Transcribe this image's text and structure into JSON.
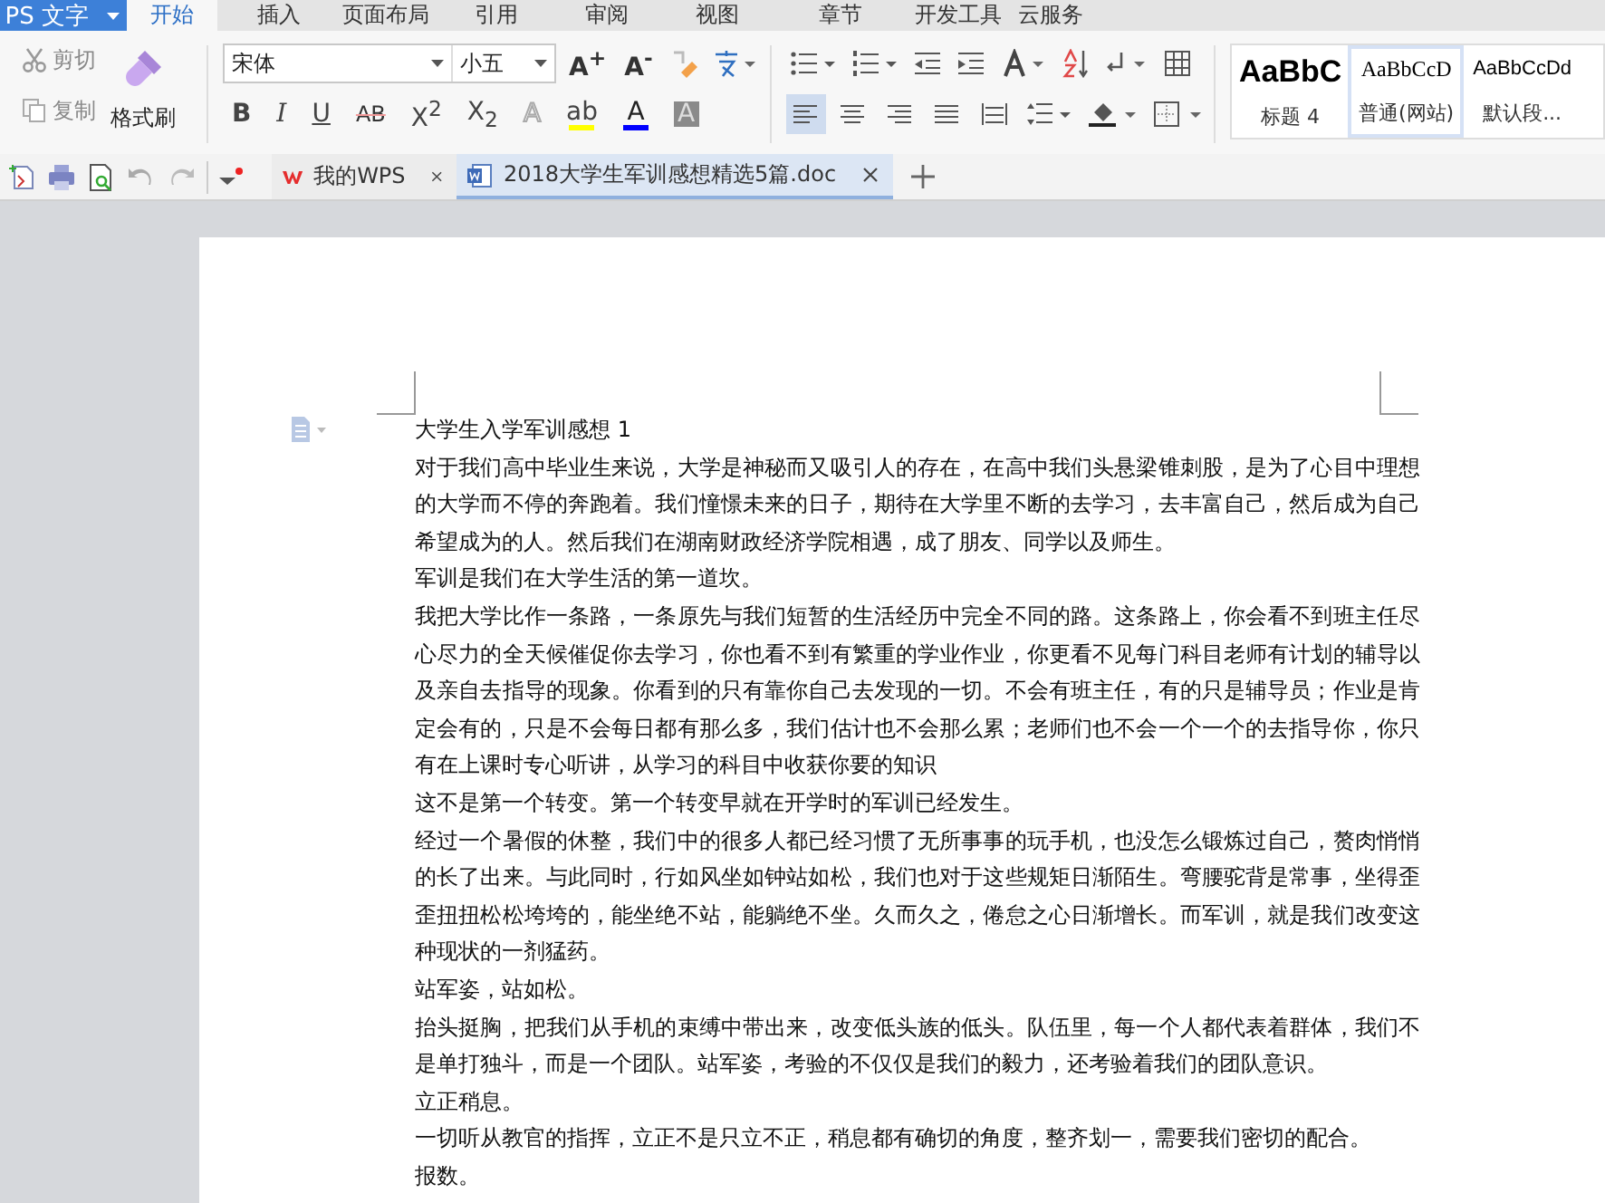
{
  "app_button": {
    "label": "PS 文字"
  },
  "ribbon_tabs": [
    {
      "label": "开始",
      "selected": true
    },
    {
      "label": "插入",
      "selected": false
    },
    {
      "label": "页面布局",
      "selected": false
    },
    {
      "label": "引用",
      "selected": false
    },
    {
      "label": "审阅",
      "selected": false
    },
    {
      "label": "视图",
      "selected": false
    },
    {
      "label": "章节",
      "selected": false
    },
    {
      "label": "开发工具",
      "selected": false
    },
    {
      "label": "云服务",
      "selected": false
    }
  ],
  "clipboard": {
    "cut": "剪切",
    "copy": "复制",
    "painter": "格式刷"
  },
  "font": {
    "name": "宋体",
    "size": "小五"
  },
  "font_size_buttons": [
    "A$^{+}$",
    "A$^{-}$"
  ],
  "format_buttons": [
    {
      "label": "B",
      "kind": "bold"
    },
    {
      "label": "I",
      "kind": "italic"
    },
    {
      "label": "U",
      "kind": "underline"
    },
    {
      "label": "AB",
      "kind": "strike"
    },
    {
      "label": "X$^{2}$",
      "kind": "plain"
    },
    {
      "label": "X$_{2}$",
      "kind": "plain"
    }
  ],
  "color_buttons": [
    {
      "label": "A",
      "kind": "outline"
    },
    {
      "label": "ab",
      "kind": "highlight",
      "color": "#ffff00"
    },
    {
      "label": "A",
      "kind": "fontcolor",
      "color": "#0000ff"
    },
    {
      "label": "A",
      "kind": "shaded"
    }
  ],
  "align_buttons": [
    {
      "kind": "left",
      "selected": true
    },
    {
      "kind": "center",
      "selected": false
    },
    {
      "kind": "right",
      "selected": false
    },
    {
      "kind": "justify",
      "selected": false
    },
    {
      "kind": "distributed",
      "selected": false
    }
  ],
  "styles": [
    {
      "preview": "AaBbC",
      "label": "标题 4",
      "kind": "heading",
      "selected": false
    },
    {
      "preview": "AaBbCcD",
      "label": "普通(网站)",
      "kind": "serif",
      "selected": true
    },
    {
      "preview": "AaBbCcDd",
      "label": "默认段...",
      "kind": "plain",
      "selected": false
    }
  ],
  "doc_tabs": [
    {
      "label": "我的WPS",
      "kind": "wps",
      "selected": false
    },
    {
      "label": "2018大学生军训感想精选5篇.doc",
      "kind": "doc",
      "selected": true
    }
  ],
  "document": {
    "paragraphs": [
      "大学生入学军训感想 1",
      "对于我们高中毕业生来说，大学是神秘而又吸引人的存在，在高中我们头悬梁锥刺股，是为了心目中理想的大学而不停的奔跑着。我们憧憬未来的日子，期待在大学里不断的去学习，去丰富自己，然后成为自己希望成为的人。然后我们在湖南财政经济学院相遇，成了朋友、同学以及师生。",
      "军训是我们在大学生活的第一道坎。",
      "我把大学比作一条路，一条原先与我们短暂的生活经历中完全不同的路。这条路上，你会看不到班主任尽心尽力的全天候催促你去学习，你也看不到有繁重的学业作业，你更看不见每门科目老师有计划的辅导以及亲自去指导的现象。你看到的只有靠你自己去发现的一切。不会有班主任，有的只是辅导员；作业是肯定会有的，只是不会每日都有那么多，我们估计也不会那么累；老师们也不会一个一个的去指导你，你只有在上课时专心听讲，从学习的科目中收获你要的知识",
      "这不是第一个转变。第一个转变早就在开学时的军训已经发生。",
      "经过一个暑假的休整，我们中的很多人都已经习惯了无所事事的玩手机，也没怎么锻炼过自己，赘肉悄悄的长了出来。与此同时，行如风坐如钟站如松，我们也对于这些规矩日渐陌生。弯腰驼背是常事，坐得歪歪扭扭松松垮垮的，能坐绝不站，能躺绝不坐。久而久之，倦怠之心日渐增长。而军训，就是我们改变这种现状的一剂猛药。",
      "站军姿，站如松。",
      "抬头挺胸，把我们从手机的束缚中带出来，改变低头族的低头。队伍里，每一个人都代表着群体，我们不是单打独斗，而是一个团队。站军姿，考验的不仅仅是我们的毅力，还考验着我们的团队意识。",
      "立正稍息。",
      "一切听从教官的指挥，立正不是只立不正，稍息都有确切的角度，整齐划一，需要我们密切的配合。",
      "报数。"
    ]
  }
}
